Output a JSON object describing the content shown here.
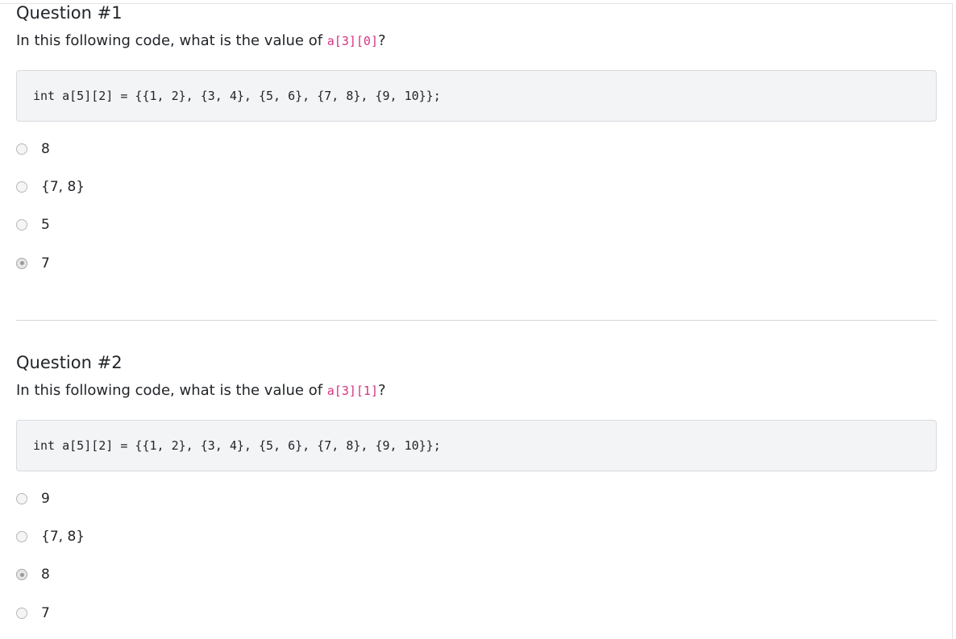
{
  "questions": [
    {
      "title": "Question #1",
      "prompt_prefix": "In this following code, what is the value of ",
      "prompt_code": "a[3][0]",
      "prompt_suffix": "?",
      "code": "int a[5][2] = {{1, 2}, {3, 4}, {5, 6}, {7, 8}, {9, 10}};",
      "options": [
        {
          "label": "8",
          "checked": false
        },
        {
          "label": "{7, 8}",
          "checked": false
        },
        {
          "label": "5",
          "checked": false
        },
        {
          "label": "7",
          "checked": true
        }
      ]
    },
    {
      "title": "Question #2",
      "prompt_prefix": "In this following code, what is the value of ",
      "prompt_code": "a[3][1]",
      "prompt_suffix": "?",
      "code": "int a[5][2] = {{1, 2}, {3, 4}, {5, 6}, {7, 8}, {9, 10}};",
      "options": [
        {
          "label": "9",
          "checked": false
        },
        {
          "label": "{7, 8}",
          "checked": false
        },
        {
          "label": "8",
          "checked": true
        },
        {
          "label": "7",
          "checked": false
        }
      ]
    }
  ],
  "colors": {
    "inline_code": "#d63384",
    "code_block_bg": "#f3f4f6",
    "text": "#212529"
  }
}
